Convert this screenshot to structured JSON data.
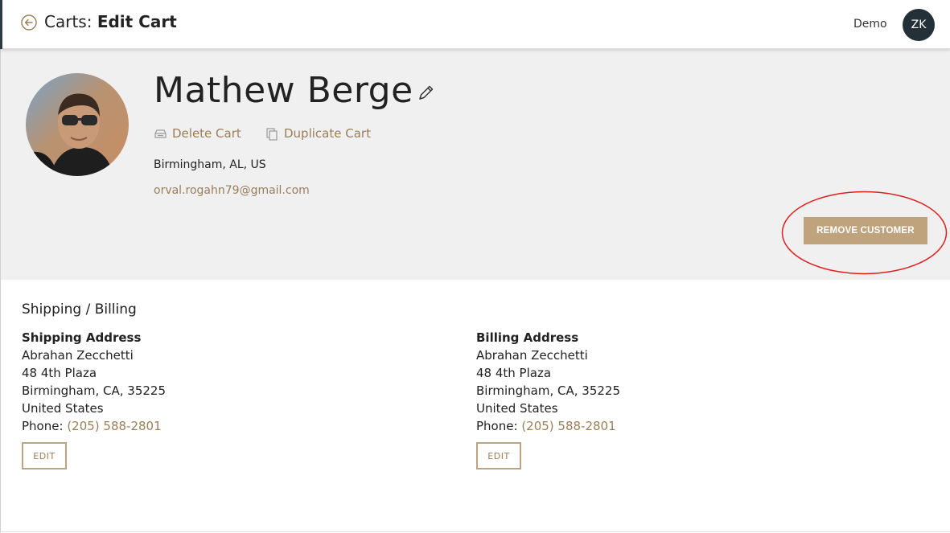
{
  "header": {
    "title_prefix": "Carts:",
    "title_bold": "Edit Cart",
    "user_label": "Demo",
    "user_initials": "ZK"
  },
  "customer": {
    "name": "Mathew Berge",
    "location": "Birmingham, AL, US",
    "email": "orval.rogahn79@gmail.com",
    "actions": {
      "delete_label": "Delete Cart",
      "duplicate_label": "Duplicate Cart"
    },
    "remove_label": "REMOVE CUSTOMER"
  },
  "shipping_billing": {
    "section_title": "Shipping / Billing",
    "shipping": {
      "heading": "Shipping Address",
      "name": "Abrahan Zecchetti",
      "street": "48 4th Plaza",
      "city_line": "Birmingham, CA, 35225",
      "country": "United States",
      "phone_label": "Phone:",
      "phone": "(205) 588-2801",
      "edit_label": "EDIT"
    },
    "billing": {
      "heading": "Billing Address",
      "name": "Abrahan Zecchetti",
      "street": "48 4th Plaza",
      "city_line": "Birmingham, CA, 35225",
      "country": "United States",
      "phone_label": "Phone:",
      "phone": "(205) 588-2801",
      "edit_label": "EDIT"
    }
  },
  "colors": {
    "accent": "#bfa37c",
    "accent_text": "#9a7e5a",
    "hero_background": "#f0f0f0",
    "avatar_background": "#243038",
    "annotation_circle": "#e02020"
  },
  "icons": [
    "back-arrow-icon",
    "pencil-icon",
    "delete-cart-icon",
    "duplicate-cart-icon"
  ]
}
